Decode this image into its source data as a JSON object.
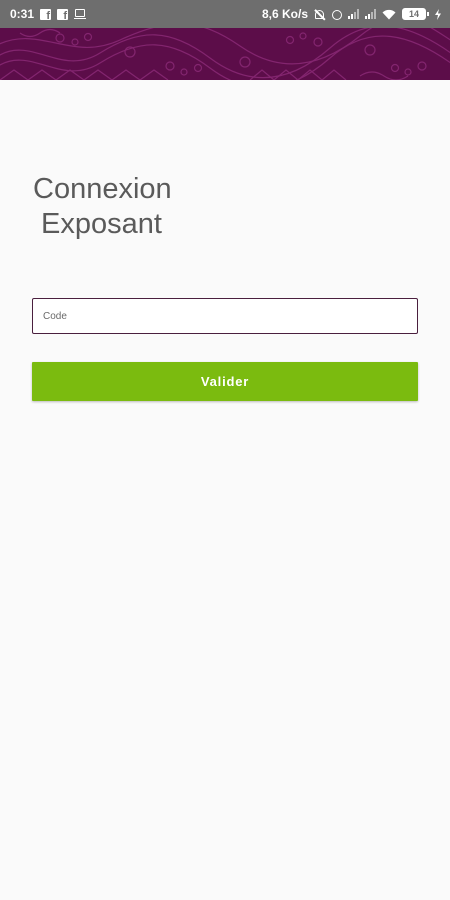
{
  "status_bar": {
    "time": "0:31",
    "network_speed": "8,6 Ko/s",
    "battery_level": "14",
    "left_icons": [
      "facebook-icon",
      "facebook-icon",
      "laptop-icon"
    ],
    "right_icons": [
      "bell-off-icon",
      "alarm-icon",
      "signal-icon",
      "signal-icon",
      "wifi-icon",
      "battery-icon",
      "charging-bolt-icon"
    ]
  },
  "header": {
    "background_color": "#5c0d49",
    "pattern_color": "#8a2a76"
  },
  "title": {
    "line1": "Connexion",
    "line2": "Exposant"
  },
  "form": {
    "code_placeholder": "Code",
    "code_value": "",
    "submit_label": "Valider"
  },
  "colors": {
    "accent_green": "#7bbb0f",
    "field_border": "#4a1f3e",
    "title_text": "#5a5a5a",
    "background": "#fafafa"
  }
}
